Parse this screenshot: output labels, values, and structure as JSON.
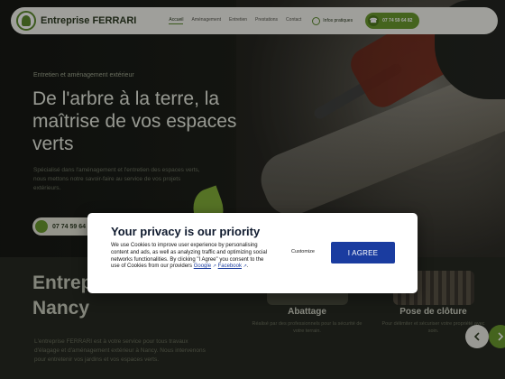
{
  "brand": {
    "name": "Entreprise FERRARI",
    "colors": {
      "primary": "#6a9a2e",
      "dark": "#2d3b22",
      "modal_button": "#1a3ca0"
    }
  },
  "nav": {
    "links": [
      "Accueil",
      "Aménagement",
      "Entretien",
      "Prestations",
      "Contact"
    ],
    "active_index": 0,
    "quote": "Infos pratiques",
    "phone": "07 74 59 64 82"
  },
  "hero": {
    "kicker": "Entretien et aménagement extérieur",
    "title": "De l'arbre à la terre, la maîtrise de vos espaces verts",
    "description": "Spécialisé dans l'aménagement et l'entretien des espaces verts, nous mettons notre savoir-faire au service de vos projets extérieurs.",
    "cta": "07 74 59 64 82"
  },
  "section": {
    "title": "Entreprise d'élagage à Nancy",
    "text": "L'entreprise FERRARI est à votre service pour tous travaux d'élagage et d'aménagement extérieur à Nancy. Nous intervenons pour entretenir vos jardins et vos espaces verts."
  },
  "services": [
    {
      "title": "Abattage",
      "desc": "Réalisé par des professionnels pour la sécurité de votre terrain."
    },
    {
      "title": "Pose de clôture",
      "desc": "Pour délimiter et sécuriser votre propriété avec soin."
    }
  ],
  "privacy": {
    "title": "Your privacy is our priority",
    "body": "We use Cookies to improve user experience by personalising content and ads, as well as analyzing traffic and optimizing social networks functionalities. By clicking \"I Agree\" you consent to the use of Cookies from our providers",
    "link_google": "Google",
    "link_facebook": "Facebook",
    "customize": "Customize",
    "agree": "I AGREE"
  }
}
